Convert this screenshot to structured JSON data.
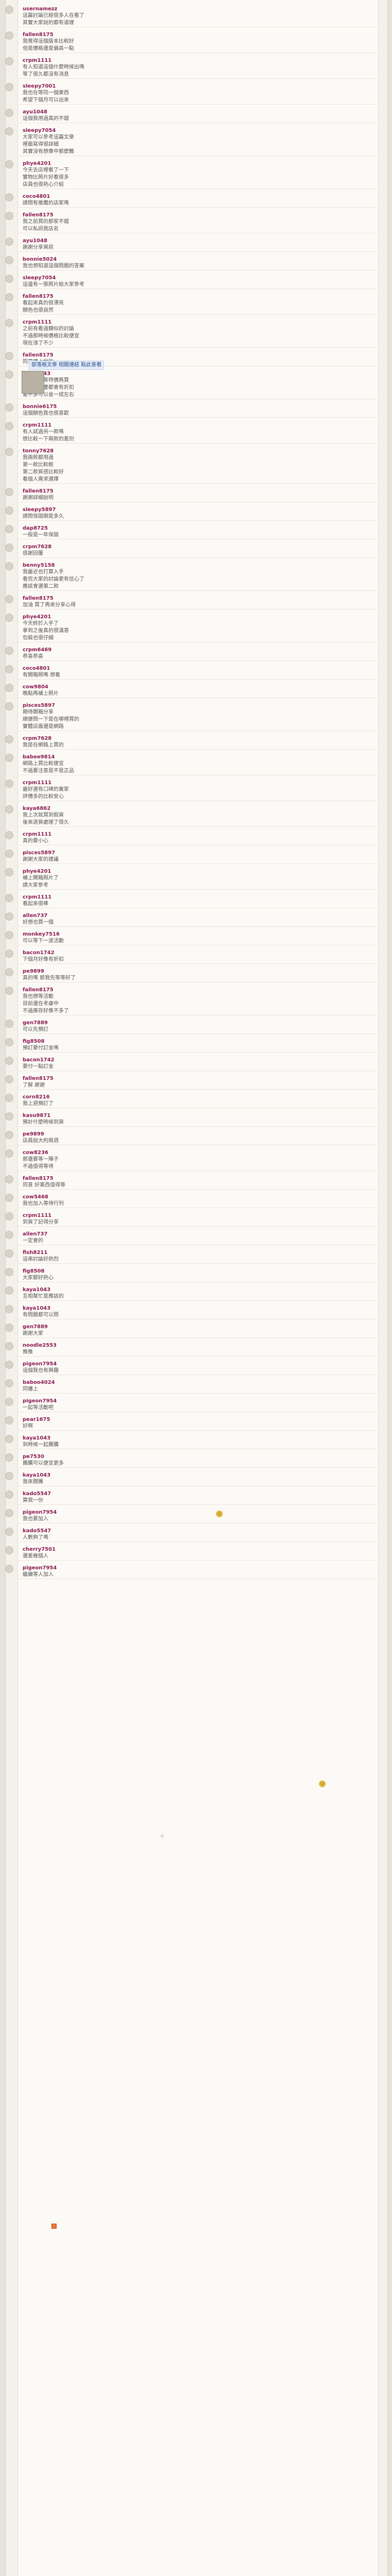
{
  "comments": [
    {
      "user": "usernamezz",
      "lines": [
        "這篇討論已經很多人在看了",
        "其實大家說的都有道理"
      ]
    },
    {
      "user": "fallen8175",
      "lines": [
        "我覺得這個版本比較好",
        "但是價格還是偏高一點"
      ]
    },
    {
      "user": "crpm1111",
      "lines": [
        "有人知道這個什麼時候出嗎",
        "等了很久都沒有消息"
      ]
    },
    {
      "user": "sleepy7001",
      "lines": [
        "我也在等同一個東西",
        "希望下個月可以出來"
      ]
    },
    {
      "user": "ayu1048",
      "lines": [
        "這個我用過真的不錯"
      ]
    },
    {
      "user": "sleepy7054",
      "lines": [
        "大家可以參考這篇文章",
        "裡面寫得很詳細",
        "其實沒有想像中那麼難"
      ]
    },
    {
      "user": "phye4201",
      "lines": [
        "今天去店裡看了一下",
        "實物比照片好看很多",
        "店員也很熱心介紹"
      ]
    },
    {
      "user": "coco4801",
      "lines": [
        "請問有推薦的店家嗎"
      ]
    },
    {
      "user": "fallen8175",
      "lines": [
        "我之前買的那家不錯",
        "可以私訊我店名"
      ]
    },
    {
      "user": "ayu1048",
      "lines": [
        "謝謝分享資訊"
      ]
    },
    {
      "user": "bonnie5024",
      "lines": [
        "我也想知道這個問題的答案"
      ]
    },
    {
      "user": "sleepy7054",
      "lines": [
        "這邊有一張照片給大家參考"
      ]
    },
    {
      "user": "fallen8175",
      "lines": [
        "看起來真的很漂亮",
        "顏色也很自然"
      ]
    },
    {
      "user": "crpm1111",
      "lines": [
        "之前有看過類似的討論",
        "不過那時候價格比較便宜",
        "現在漲了不少"
      ]
    },
    {
      "user": "fallen8175",
      "lines": [
        "同意樓上說的"
      ]
    },
    {
      "user": "kaya1043",
      "lines": [
        "其實可以等特價再買",
        "通常週年慶都會有折扣",
        "差不多可以省一成左右"
      ]
    },
    {
      "user": "bonnie6175",
      "lines": [
        "這個顏色我也很喜歡"
      ]
    },
    {
      "user": "crpm1111",
      "lines": [
        "有人試過另一款嗎",
        "想比較一下兩款的差別"
      ]
    },
    {
      "user": "tonny7628",
      "lines": [
        "我兩款都用過",
        "第一款比較輕",
        "第二款質感比較好",
        "看個人需求選擇"
      ]
    },
    {
      "user": "fallen8175",
      "lines": [
        "謝謝詳細說明"
      ]
    },
    {
      "user": "sleepy5897",
      "lines": [
        "請問保固期是多久"
      ]
    },
    {
      "user": "dap8725",
      "lines": [
        "一般是一年保固"
      ]
    },
    {
      "user": "crpm7628",
      "lines": [
        "感謝回覆"
      ]
    },
    {
      "user": "benny5158",
      "lines": [
        "我最近也打算入手",
        "看完大家的討論更有信心了",
        "應該會選第二款"
      ]
    },
    {
      "user": "fallen8175",
      "lines": [
        "加油 買了再來分享心得"
      ]
    },
    {
      "user": "phye4201",
      "lines": [
        "今天終於入手了",
        "拿到之後真的很滿意",
        "包裝也很仔細"
      ]
    },
    {
      "user": "crpm6469",
      "lines": [
        "恭喜恭喜"
      ]
    },
    {
      "user": "coco4801",
      "lines": [
        "有開箱照嗎 想看"
      ]
    },
    {
      "user": "cow9804",
      "lines": [
        "晚點再補上照片"
      ]
    },
    {
      "user": "pisces5897",
      "lines": [
        "期待開箱分享",
        "順便問一下是在哪裡買的",
        "實體店面還是網路"
      ]
    },
    {
      "user": "crpm7628",
      "lines": [
        "我是在網路上買的"
      ]
    },
    {
      "user": "babee9814",
      "lines": [
        "網路上買比較便宜",
        "不過要注意是不是正品"
      ]
    },
    {
      "user": "crpm1111",
      "lines": [
        "最好選有口碑的賣家",
        "評價多的比較安心"
      ]
    },
    {
      "user": "kaya6862",
      "lines": [
        "我上次就買到假貨",
        "後來退貨處理了很久"
      ]
    },
    {
      "user": "crpm1111",
      "lines": [
        "真的要小心"
      ]
    },
    {
      "user": "pisces5897",
      "lines": [
        "謝謝大家的建議"
      ]
    },
    {
      "user": "phye4201",
      "lines": [
        "補上開箱照片了",
        "請大家參考"
      ]
    },
    {
      "user": "crpm1111",
      "lines": [
        "看起來很棒"
      ]
    },
    {
      "user": "allen737",
      "lines": [
        "好想也買一個"
      ]
    },
    {
      "user": "monkey7516",
      "lines": [
        "可以等下一波活動"
      ]
    },
    {
      "user": "bacon1742",
      "lines": [
        "下個月好像有折扣"
      ]
    },
    {
      "user": "pe9899",
      "lines": [
        "真的嗎 那我先等等好了"
      ]
    },
    {
      "user": "fallen8175",
      "lines": [
        "我也想等活動",
        "目前還在考慮中",
        "不過庫存好像不多了"
      ]
    },
    {
      "user": "gen7889",
      "lines": [
        "可以先預訂"
      ]
    },
    {
      "user": "fig8508",
      "lines": [
        "預訂要付訂金嗎"
      ]
    },
    {
      "user": "bacon1742",
      "lines": [
        "要付一點訂金"
      ]
    },
    {
      "user": "fallen8175",
      "lines": [
        "了解 謝謝"
      ]
    },
    {
      "user": "corn8216",
      "lines": [
        "我上週預訂了"
      ]
    },
    {
      "user": "kasu9871",
      "lines": [
        "預計什麼時候到貨"
      ]
    },
    {
      "user": "pe9899",
      "lines": [
        "店員說大約兩週"
      ]
    },
    {
      "user": "cow8236",
      "lines": [
        "那還要等一陣子",
        "不過值得等待"
      ]
    },
    {
      "user": "fallen8175",
      "lines": [
        "同意 好東西值得等"
      ]
    },
    {
      "user": "cow5468",
      "lines": [
        "我也加入等待行列"
      ]
    },
    {
      "user": "crpm1111",
      "lines": [
        "到貨了記得分享"
      ]
    },
    {
      "user": "allen737",
      "lines": [
        "一定會的"
      ]
    },
    {
      "user": "fish8211",
      "lines": [
        "這串討論好熱烈"
      ]
    },
    {
      "user": "fig8508",
      "lines": [
        "大家都好熱心"
      ]
    },
    {
      "user": "kaya1043",
      "lines": [
        "互相幫忙是應該的"
      ]
    },
    {
      "user": "kaya1043",
      "lines": [
        "有問題都可以問"
      ]
    },
    {
      "user": "gen7889",
      "lines": [
        "謝謝大家"
      ]
    },
    {
      "user": "noodle2553",
      "lines": [
        "推推"
      ]
    },
    {
      "user": "pigeon7954",
      "lines": [
        "這個我也有興趣"
      ]
    },
    {
      "user": "baboo4024",
      "lines": [
        "同樓上"
      ]
    },
    {
      "user": "pigeon7954",
      "lines": [
        "一起等活動吧"
      ]
    },
    {
      "user": "pear1675",
      "lines": [
        "好啊"
      ]
    },
    {
      "user": "kaya1043",
      "lines": [
        "到時候一起團購"
      ]
    },
    {
      "user": "pe7530",
      "lines": [
        "團購可以便宜更多"
      ]
    },
    {
      "user": "kaya1043",
      "lines": [
        "我來開團"
      ]
    },
    {
      "user": "kado5547",
      "lines": [
        "算我一份"
      ]
    },
    {
      "user": "pigeon7954",
      "lines": [
        "我也要加入"
      ]
    },
    {
      "user": "kado5547",
      "lines": [
        "人數夠了嗎"
      ]
    },
    {
      "user": "cherry7501",
      "lines": [
        "還差幾個人"
      ]
    },
    {
      "user": "pigeon7954",
      "lines": [
        "繼續等人加入"
      ]
    }
  ],
  "thumb": {
    "title": "部落格文章 相關連結 點此查看"
  },
  "icons": {
    "emoji": "smile-emoji",
    "hand": "hand-icon",
    "badge": "new-badge"
  }
}
